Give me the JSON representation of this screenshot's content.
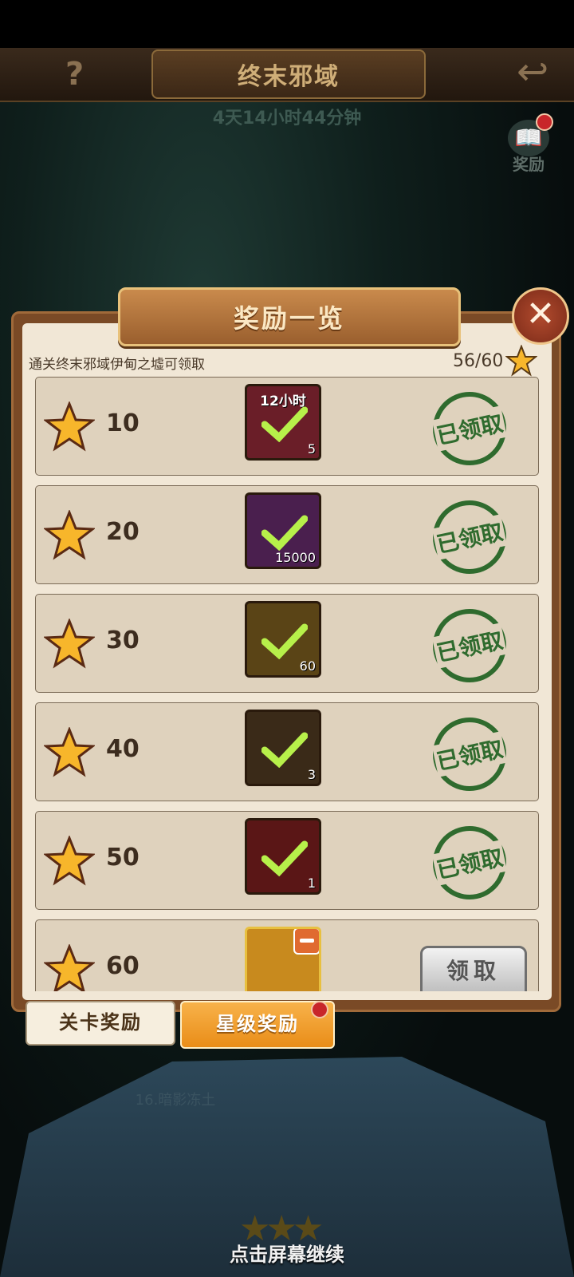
{
  "header": {
    "title": "终末邪域",
    "help": "?",
    "back": "↩"
  },
  "timer": "4天14小时44分钟",
  "reward_button": {
    "label": "奖励"
  },
  "panel": {
    "title": "奖励一览",
    "subtitle": "通关终末邪域伊甸之墟可领取",
    "progress": "56/60",
    "rows": [
      {
        "stars": "10",
        "item_tag": "12小时",
        "qty": "5",
        "status": "已领取",
        "item_color": "#6a1e28"
      },
      {
        "stars": "20",
        "item_tag": "",
        "qty": "15000",
        "status": "已领取",
        "item_color": "#4a1f4e"
      },
      {
        "stars": "30",
        "item_tag": "",
        "qty": "60",
        "status": "已领取",
        "item_color": "#5a4416"
      },
      {
        "stars": "40",
        "item_tag": "",
        "qty": "3",
        "status": "已领取",
        "item_color": "#3a2a18"
      },
      {
        "stars": "50",
        "item_tag": "",
        "qty": "1",
        "status": "已领取",
        "item_color": "#5a1616"
      },
      {
        "stars": "60",
        "item_tag": "",
        "qty": "",
        "status": "",
        "claim_label": "领取",
        "item_color": "#c88a1e"
      }
    ]
  },
  "tabs": {
    "stage_rewards": "关卡奖励",
    "star_rewards": "星级奖励"
  },
  "stage_label": "16.暗影冻土",
  "continue_hint": "点击屏幕继续",
  "colors": {
    "accent": "#f2a93a",
    "stamp": "#2f6b2e",
    "star": "#f7b62b"
  }
}
